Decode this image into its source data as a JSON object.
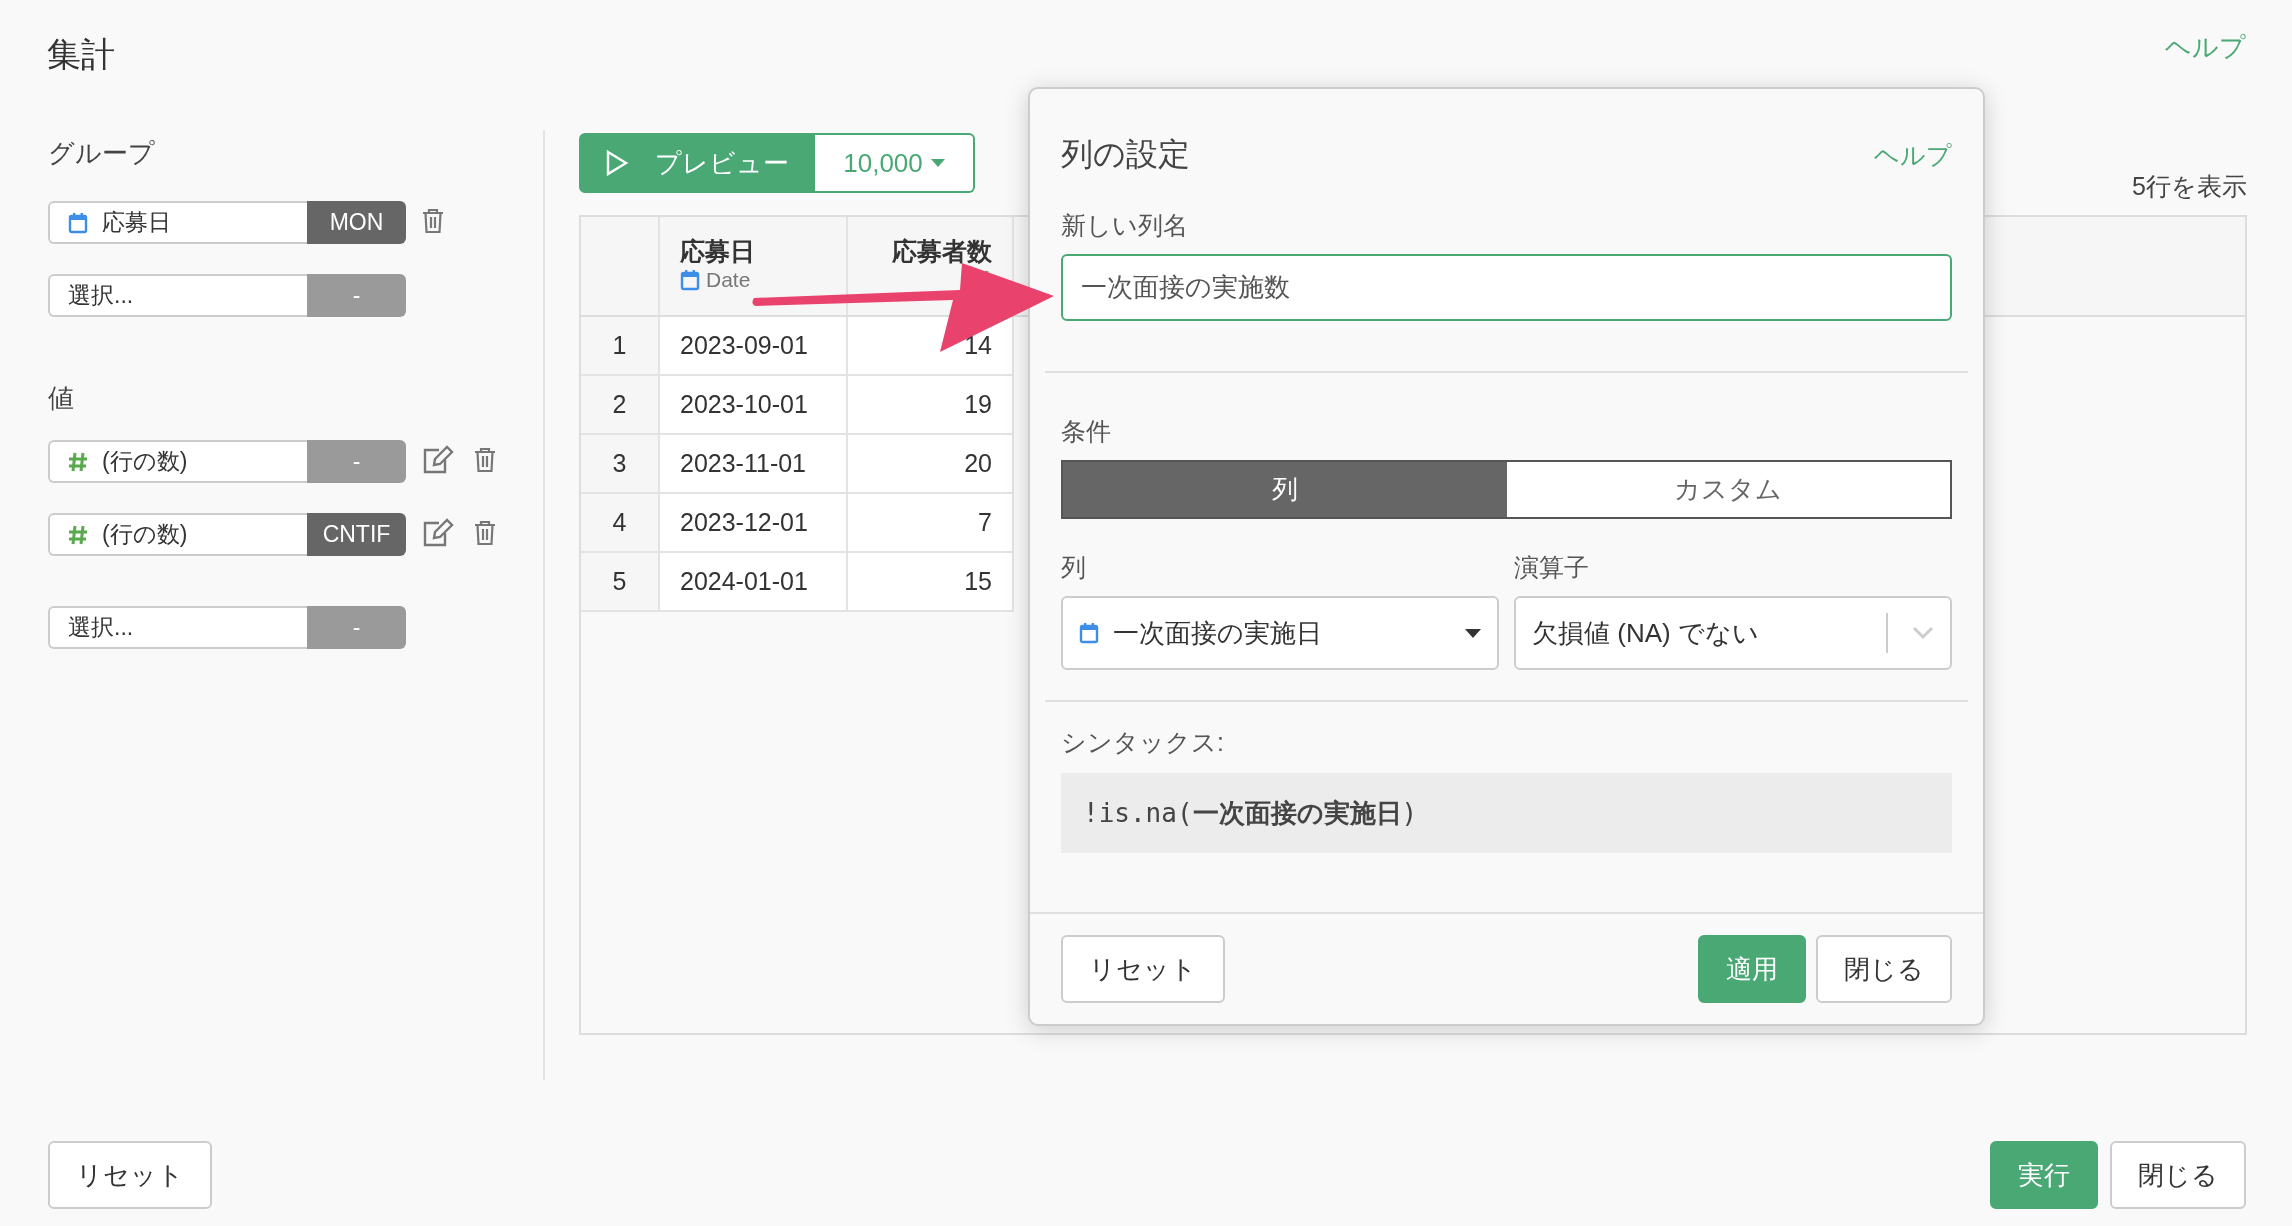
{
  "title": "集計",
  "help_link": "ヘルプ",
  "groups": {
    "label": "グループ",
    "items": [
      {
        "kind": "date",
        "field": "応募日",
        "function": "MON",
        "function_set": true,
        "editable": false,
        "deletable": true
      },
      {
        "field": "選択...",
        "function": "-",
        "function_set": false,
        "editable": false,
        "deletable": false
      }
    ]
  },
  "values": {
    "label": "値",
    "items": [
      {
        "kind": "number",
        "field": "(行の数)",
        "function": "-",
        "function_set": false,
        "editable": true,
        "deletable": true
      },
      {
        "kind": "number",
        "field": "(行の数)",
        "function": "CNTIF",
        "function_set": true,
        "editable": true,
        "deletable": true
      },
      {
        "field": "選択...",
        "function": "-",
        "function_set": false,
        "editable": false,
        "deletable": false
      }
    ]
  },
  "preview": {
    "label": "プレビュー",
    "row_limit": "10,000",
    "row_count": "5行を表示"
  },
  "table": {
    "columns": [
      {
        "name": "応募日",
        "kind": "date",
        "type_label": "Date"
      },
      {
        "name": "応募者数",
        "kind": "number"
      }
    ],
    "rows": [
      {
        "index": "1",
        "cells": [
          "2023-09-01",
          "14"
        ]
      },
      {
        "index": "2",
        "cells": [
          "2023-10-01",
          "19"
        ]
      },
      {
        "index": "3",
        "cells": [
          "2023-11-01",
          "20"
        ]
      },
      {
        "index": "4",
        "cells": [
          "2023-12-01",
          "7"
        ]
      },
      {
        "index": "5",
        "cells": [
          "2024-01-01",
          "15"
        ]
      }
    ]
  },
  "dialog": {
    "title": "列の設定",
    "help_link": "ヘルプ",
    "new_name_label": "新しい列名",
    "new_name_value": "一次面接の実施数",
    "condition_label": "条件",
    "tabs": [
      {
        "label": "列",
        "selected": true
      },
      {
        "label": "カスタム",
        "selected": false
      }
    ],
    "column_label": "列",
    "column_value": {
      "kind": "date",
      "text": "一次面接の実施日"
    },
    "operator_label": "演算子",
    "operator_value": "欠損値 (NA) でない",
    "syntax_label": "シンタックス:",
    "syntax": "!is.na(**一次面接の実施日**)",
    "buttons": {
      "reset": "リセット",
      "apply": "適用",
      "close": "閉じる"
    }
  },
  "footer": {
    "reset": "リセット",
    "run": "実行",
    "close": "閉じる"
  }
}
